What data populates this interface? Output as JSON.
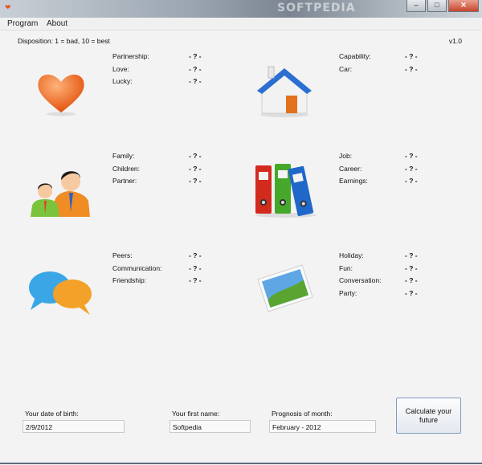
{
  "window": {
    "watermark": "SOFTPEDIA",
    "minimize_icon": "minimize-icon",
    "maximize_icon": "maximize-icon",
    "close_icon": "close-icon",
    "app_icon": "heart-icon"
  },
  "menu": {
    "items": [
      "Program",
      "About"
    ]
  },
  "header": {
    "hint": "Disposition: 1 = bad, 10 = best",
    "version": "v1.0"
  },
  "groups": [
    {
      "icon": "heart-icon",
      "fields": [
        {
          "label": "Partnership:",
          "value": "- ? -"
        },
        {
          "label": "Love:",
          "value": "- ? -"
        },
        {
          "label": "Lucky:",
          "value": "- ? -"
        }
      ]
    },
    {
      "icon": "house-icon",
      "fields": [
        {
          "label": "Capability:",
          "value": "- ? -"
        },
        {
          "label": "Car:",
          "value": "- ? -"
        }
      ]
    },
    {
      "icon": "family-icon",
      "fields": [
        {
          "label": "Family:",
          "value": "- ? -"
        },
        {
          "label": "Children:",
          "value": "- ? -"
        },
        {
          "label": "Partner:",
          "value": "- ? -"
        }
      ]
    },
    {
      "icon": "binders-icon",
      "fields": [
        {
          "label": "Job:",
          "value": "- ? -"
        },
        {
          "label": "Career:",
          "value": "- ? -"
        },
        {
          "label": "Earnings:",
          "value": "- ? -"
        }
      ]
    },
    {
      "icon": "chat-bubbles-icon",
      "fields": [
        {
          "label": "Peers:",
          "value": "- ? -"
        },
        {
          "label": "Communication:",
          "value": "- ? -"
        },
        {
          "label": "Friendship:",
          "value": "- ? -"
        }
      ]
    },
    {
      "icon": "photo-icon",
      "fields": [
        {
          "label": "Holiday:",
          "value": "- ? -"
        },
        {
          "label": "Fun:",
          "value": "- ? -"
        },
        {
          "label": "Conversation:",
          "value": "- ? -"
        },
        {
          "label": "Party:",
          "value": "- ? -"
        }
      ]
    }
  ],
  "inputs": {
    "birth_label": "Your date of birth:",
    "birth_value": "2/9/2012",
    "name_label": "Your first name:",
    "name_value": "Softpedia",
    "month_label": "Prognosis of month:",
    "month_value": "February  -  2012"
  },
  "calc_button": "Calculate your future",
  "colors": {
    "accent": "#e8561f",
    "button_border": "#7d9cbf"
  }
}
